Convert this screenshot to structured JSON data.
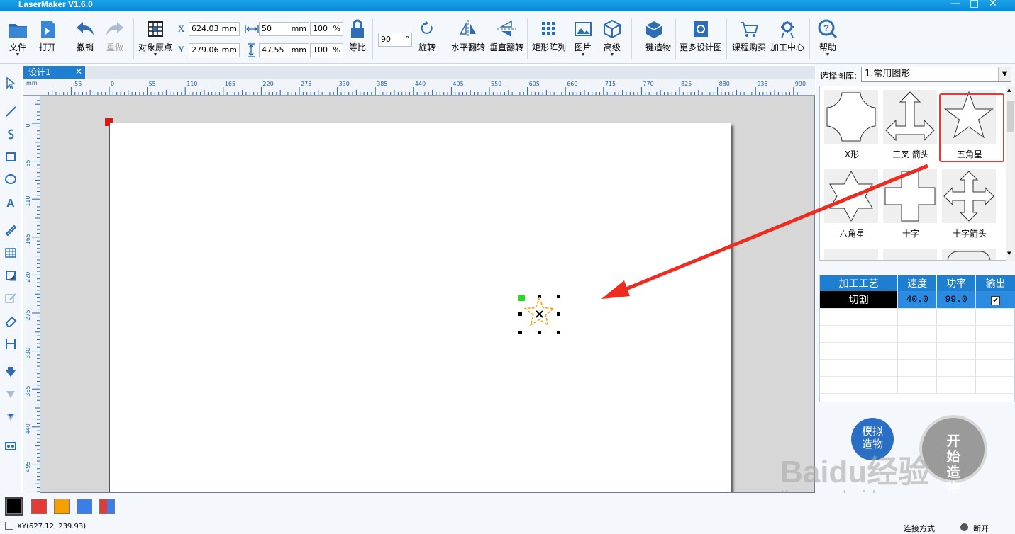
{
  "window": {
    "title": "LaserMaker V1.6.0",
    "min": "—",
    "max": "□",
    "close": "✕"
  },
  "toolbar": {
    "file": "文件",
    "open": "打开",
    "undo": "撤销",
    "redo": "重做",
    "origin": "对象原点",
    "x_label": "X",
    "x_value": "624.03",
    "y_label": "Y",
    "y_value": "279.06",
    "unit_mm": "mm",
    "w_value": "50",
    "h_value": "47.55",
    "w_pct": "100",
    "h_pct": "100",
    "pct": "%",
    "ratio": "等比",
    "rot_value": "90",
    "deg": "°",
    "rotate": "旋转",
    "hflip": "水平翻转",
    "vflip": "垂直翻转",
    "array": "矩形阵列",
    "picture": "图片",
    "advanced": "高级",
    "oneclick": "一键造物",
    "more_designs": "更多设计图",
    "course": "课程购买",
    "center": "加工中心",
    "help": "帮助"
  },
  "tab": {
    "label": "设计1",
    "close": "✕"
  },
  "ruler": {
    "h_ticks": [
      "-55",
      "0",
      "55",
      "110",
      "165",
      "220",
      "275",
      "330",
      "385",
      "440",
      "495",
      "550",
      "605",
      "660",
      "715",
      "770",
      "825",
      "880",
      "935",
      "990"
    ],
    "v_ticks": [
      "0",
      "55",
      "110",
      "165",
      "220",
      "275",
      "330",
      "385",
      "440",
      "495"
    ],
    "unit": "mm"
  },
  "library": {
    "label": "选择图库:",
    "selected": "1.常用图形",
    "shapes": [
      {
        "name": "X形",
        "icon": "x-shape-icon"
      },
      {
        "name": "三叉 箭头",
        "icon": "three-way-arrow-icon"
      },
      {
        "name": "五角星",
        "icon": "five-point-star-icon",
        "selected": true
      },
      {
        "name": "六角星",
        "icon": "six-point-star-icon"
      },
      {
        "name": "十字",
        "icon": "cross-icon"
      },
      {
        "name": "十字箭头",
        "icon": "cross-arrow-icon"
      }
    ]
  },
  "process": {
    "headers": [
      "加工工艺",
      "速度",
      "功率",
      "输出"
    ],
    "row": {
      "type": "切割",
      "speed": "40.0",
      "power": "99.0",
      "output": "✔"
    }
  },
  "buttons": {
    "simulate": "模拟造物",
    "start": "开始造物"
  },
  "colors": [
    "#000000",
    "#e53935",
    "#f5a000",
    "#3b7ee8",
    "multi"
  ],
  "status": {
    "coords": "XY(627.12, 239.93)",
    "connection_label": "连接方式",
    "connection_state": "断开"
  },
  "watermark": {
    "brand": "Baidu经验",
    "url": "jingyan.baidu.com"
  }
}
